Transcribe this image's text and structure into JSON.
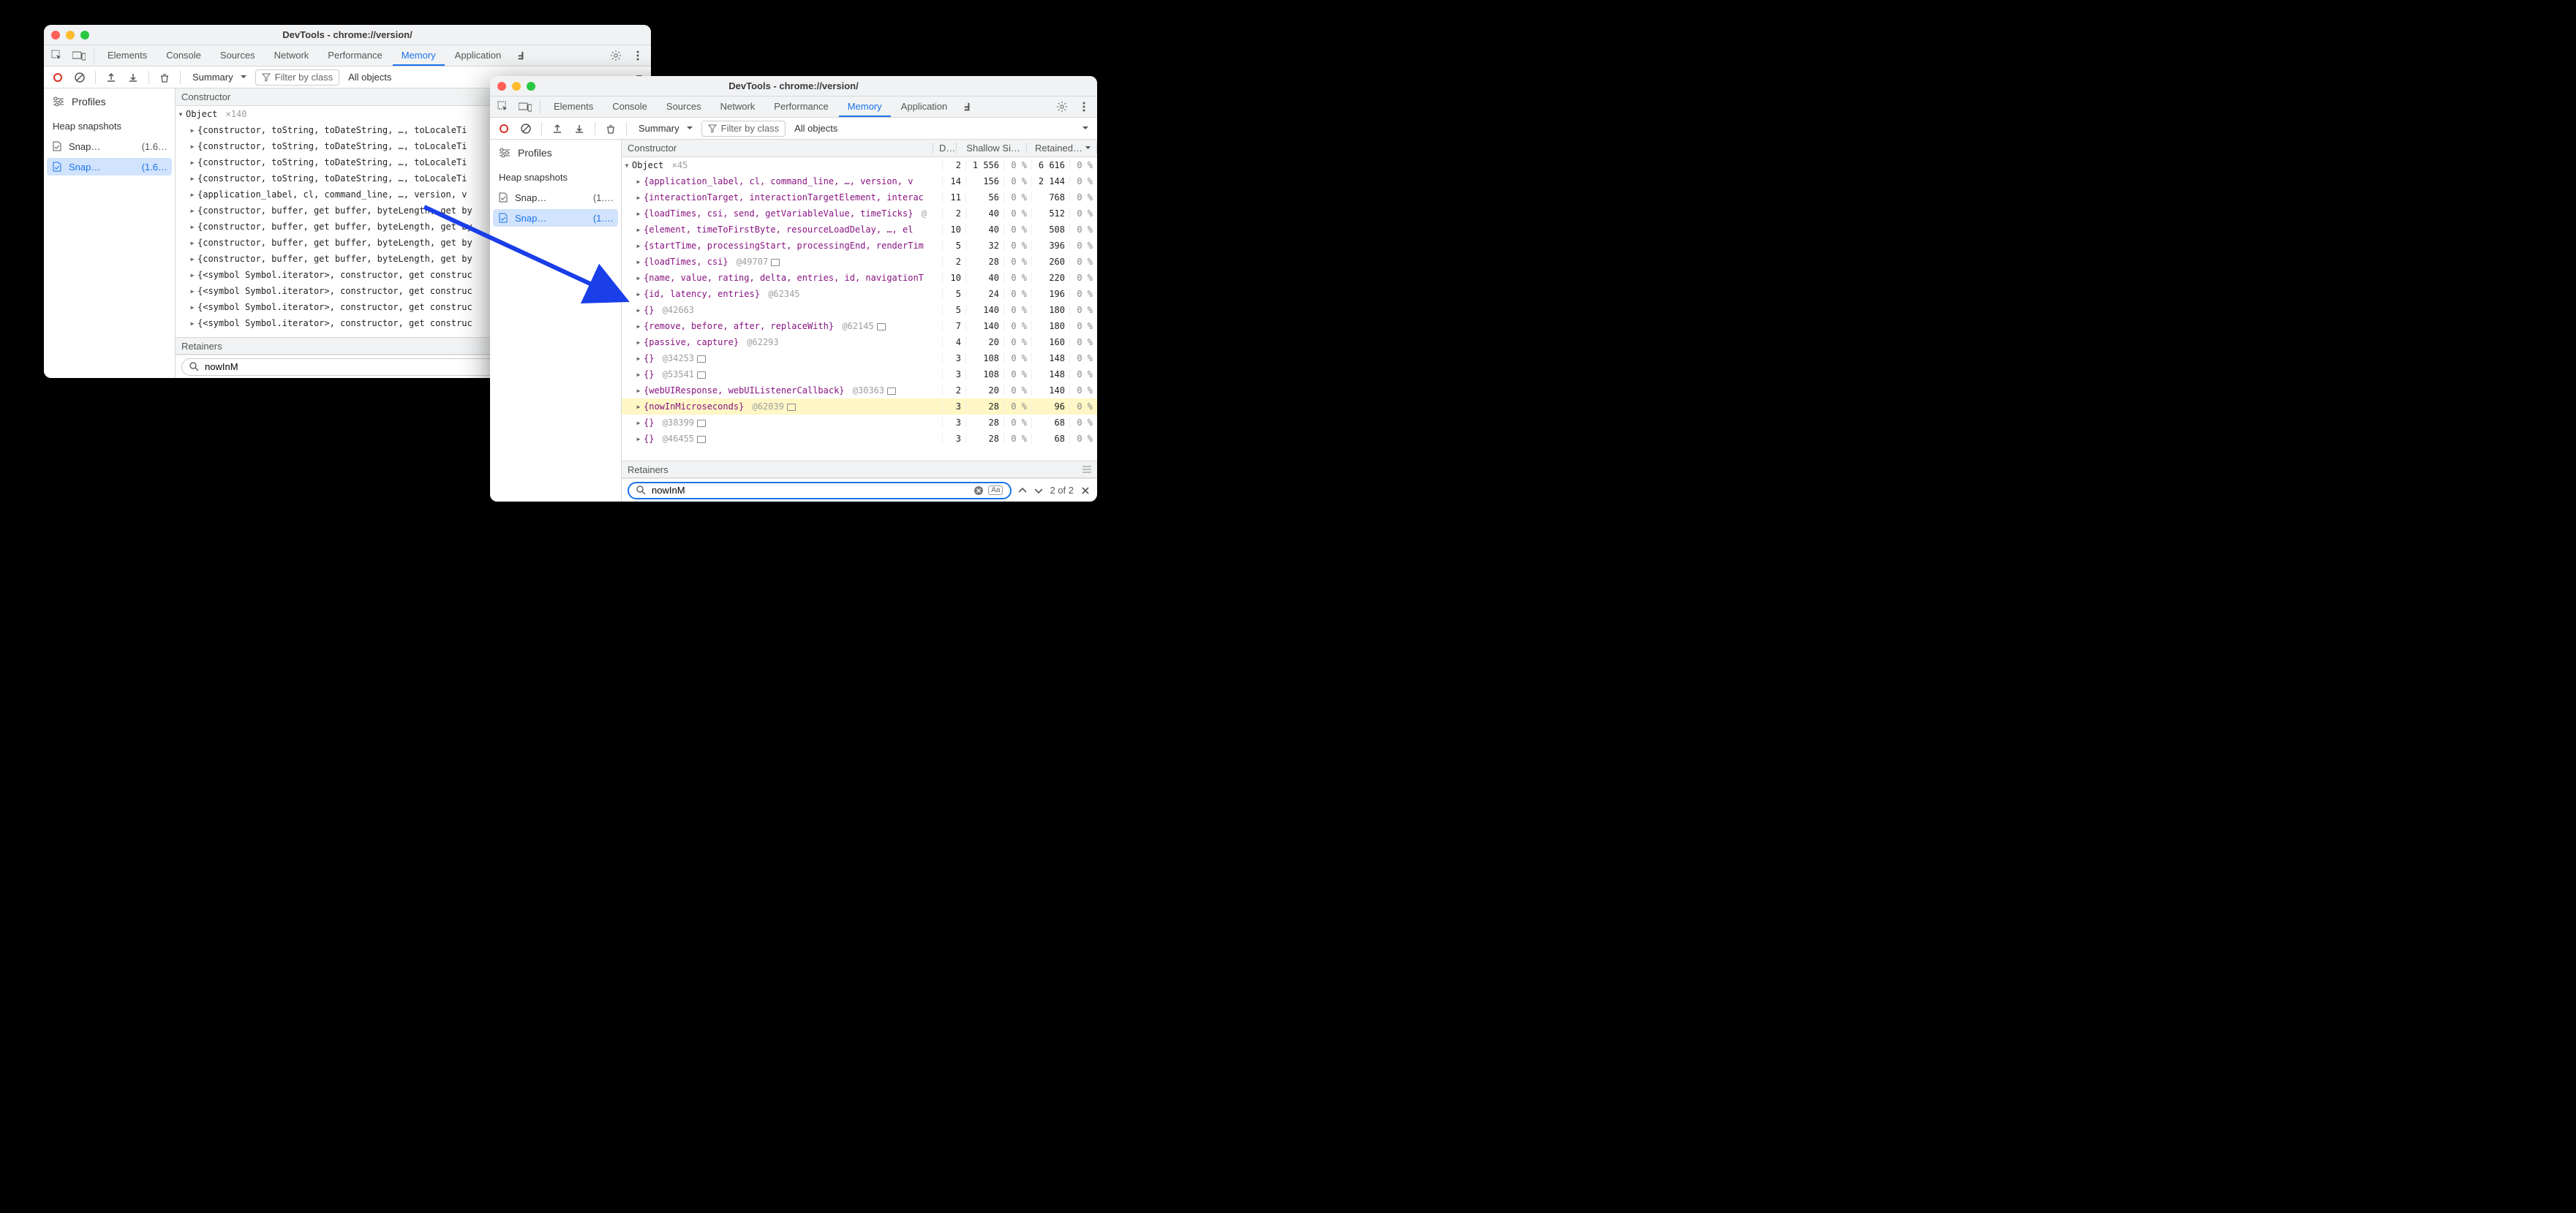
{
  "title_text": "DevTools - chrome://version/",
  "tabs": [
    "Elements",
    "Console",
    "Sources",
    "Network",
    "Performance",
    "Memory",
    "Application"
  ],
  "active_tab": "Memory",
  "toolbar": {
    "summary_label": "Summary",
    "filter_placeholder": "Filter by class",
    "all_objects_label": "All objects"
  },
  "sidebar": {
    "profiles_label": "Profiles",
    "heap_label": "Heap snapshots",
    "items_a": [
      {
        "name": "Snap…",
        "size": "(1.6…"
      },
      {
        "name": "Snap…",
        "size": "(1.6…"
      }
    ],
    "items_b": [
      {
        "name": "Snap…",
        "size": "(1.…"
      },
      {
        "name": "Snap…",
        "size": "(1.…"
      }
    ]
  },
  "headers_a": {
    "constructor": "Constructor"
  },
  "headers_b": {
    "constructor": "Constructor",
    "di": "Di…",
    "shallow": "Shallow Si…",
    "retained": "Retained…"
  },
  "retainers_label": "Retainers",
  "search": {
    "value": "nowInM",
    "counter": "2 of 2",
    "aa": "Aa"
  },
  "windowA": {
    "root": {
      "label": "Object",
      "count": "×140"
    },
    "rows": [
      "{constructor, toString, toDateString, …, toLocaleTi",
      "{constructor, toString, toDateString, …, toLocaleTi",
      "{constructor, toString, toDateString, …, toLocaleTi",
      "{constructor, toString, toDateString, …, toLocaleTi",
      "{application_label, cl, command_line, …, version, v",
      "{constructor, buffer, get buffer, byteLength, get by",
      "{constructor, buffer, get buffer, byteLength, get by",
      "{constructor, buffer, get buffer, byteLength, get by",
      "{constructor, buffer, get buffer, byteLength, get by",
      "{<symbol Symbol.iterator>, constructor, get construc",
      "{<symbol Symbol.iterator>, constructor, get construc",
      "{<symbol Symbol.iterator>, constructor, get construc",
      "{<symbol Symbol.iterator>, constructor, get construc"
    ]
  },
  "windowB": {
    "root": {
      "label": "Object",
      "count": "×45",
      "di": "2",
      "sh": "1 556",
      "shp": "0 %",
      "re": "6 616",
      "rep": "0 %"
    },
    "rows": [
      {
        "txt": "{application_label, cl, command_line, …, version, v",
        "di": "14",
        "sh": "156",
        "shp": "0 %",
        "re": "2 144",
        "rep": "0 %"
      },
      {
        "txt": "{interactionTarget, interactionTargetElement, interac",
        "di": "11",
        "sh": "56",
        "shp": "0 %",
        "re": "768",
        "rep": "0 %"
      },
      {
        "txt": "{loadTimes, csi, send, getVariableValue, timeTicks}",
        "tag": "@",
        "di": "2",
        "sh": "40",
        "shp": "0 %",
        "re": "512",
        "rep": "0 %"
      },
      {
        "txt": "{element, timeToFirstByte, resourceLoadDelay, …, el",
        "di": "10",
        "sh": "40",
        "shp": "0 %",
        "re": "508",
        "rep": "0 %"
      },
      {
        "txt": "{startTime, processingStart, processingEnd, renderTim",
        "di": "5",
        "sh": "32",
        "shp": "0 %",
        "re": "396",
        "rep": "0 %"
      },
      {
        "txt": "{loadTimes, csi}",
        "tag": "@49707",
        "chip": true,
        "di": "2",
        "sh": "28",
        "shp": "0 %",
        "re": "260",
        "rep": "0 %"
      },
      {
        "txt": "{name, value, rating, delta, entries, id, navigationT",
        "di": "10",
        "sh": "40",
        "shp": "0 %",
        "re": "220",
        "rep": "0 %"
      },
      {
        "txt": "{id, latency, entries}",
        "tag": "@62345",
        "di": "5",
        "sh": "24",
        "shp": "0 %",
        "re": "196",
        "rep": "0 %"
      },
      {
        "txt": "{}",
        "tag": "@42663",
        "di": "5",
        "sh": "140",
        "shp": "0 %",
        "re": "180",
        "rep": "0 %"
      },
      {
        "txt": "{remove, before, after, replaceWith}",
        "tag": "@62145",
        "chip": true,
        "di": "7",
        "sh": "140",
        "shp": "0 %",
        "re": "180",
        "rep": "0 %"
      },
      {
        "txt": "{passive, capture}",
        "tag": "@62293",
        "di": "4",
        "sh": "20",
        "shp": "0 %",
        "re": "160",
        "rep": "0 %"
      },
      {
        "txt": "{}",
        "tag": "@34253",
        "chip": true,
        "di": "3",
        "sh": "108",
        "shp": "0 %",
        "re": "148",
        "rep": "0 %"
      },
      {
        "txt": "{}",
        "tag": "@53541",
        "chip": true,
        "di": "3",
        "sh": "108",
        "shp": "0 %",
        "re": "148",
        "rep": "0 %"
      },
      {
        "txt": "{webUIResponse, webUIListenerCallback}",
        "tag": "@30363",
        "chip": true,
        "di": "2",
        "sh": "20",
        "shp": "0 %",
        "re": "140",
        "rep": "0 %"
      },
      {
        "txt": "{nowInMicroseconds}",
        "tag": "@62039",
        "chip": true,
        "hl": true,
        "di": "3",
        "sh": "28",
        "shp": "0 %",
        "re": "96",
        "rep": "0 %"
      },
      {
        "txt": "{}",
        "tag": "@38399",
        "chip": true,
        "di": "3",
        "sh": "28",
        "shp": "0 %",
        "re": "68",
        "rep": "0 %"
      },
      {
        "txt": "{}",
        "tag": "@46455",
        "chip": true,
        "di": "3",
        "sh": "28",
        "shp": "0 %",
        "re": "68",
        "rep": "0 %"
      }
    ]
  }
}
